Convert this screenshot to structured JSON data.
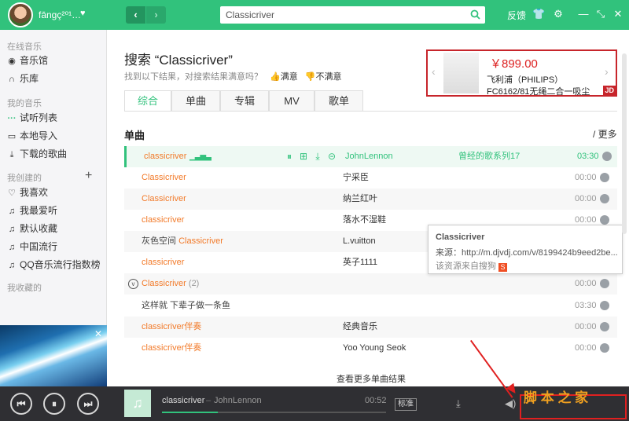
{
  "topbar": {
    "username": "fāngç²⁰¹…",
    "search_value": "Classicriver",
    "feedback": "反馈",
    "icons": [
      "shirt-icon",
      "gear-icon",
      "minimize-icon",
      "shrink-icon",
      "close-icon"
    ]
  },
  "sidebar": {
    "section_online": "在线音乐",
    "online_items": [
      {
        "label": "音乐馆",
        "icon": "music-hall-icon"
      },
      {
        "label": "乐库",
        "icon": "headphone-icon"
      }
    ],
    "section_my": "我的音乐",
    "my_items": [
      {
        "label": "试听列表",
        "icon": "playlist-icon"
      },
      {
        "label": "本地导入",
        "icon": "monitor-icon"
      },
      {
        "label": "下载的歌曲",
        "icon": "download-icon"
      }
    ],
    "section_created": "我创建的",
    "created_items": [
      {
        "label": "我喜欢",
        "icon": "heart-icon"
      },
      {
        "label": "我最爱听",
        "icon": "note-icon"
      },
      {
        "label": "默认收藏",
        "icon": "note-icon"
      },
      {
        "label": "中国流行",
        "icon": "note-icon"
      },
      {
        "label": "QQ音乐流行指数榜",
        "icon": "note-icon"
      }
    ],
    "section_collected": "我收藏的"
  },
  "main": {
    "title": "搜索 “Classicriver”",
    "subline_text": "找到以下结果，对搜索结果满意吗？",
    "satisfied": "满意",
    "unsatisfied": "不满意",
    "ad": {
      "price": "￥899.00",
      "line1": "飞利浦（PHILIPS）",
      "line2": "FC6162/81无绳二合一吸尘",
      "badge": "JD"
    },
    "tabs": [
      "综合",
      "单曲",
      "专辑",
      "MV",
      "歌单"
    ],
    "section_title": "单曲",
    "more": "/ 更多",
    "songs": [
      {
        "pre": "",
        "name": "classicriver",
        "cnt": "",
        "singer": "JohnLennon",
        "album": "曾经的歌系列17",
        "dur": "03:30"
      },
      {
        "pre": "",
        "name": "Classicriver",
        "cnt": "",
        "singer": "宁采臣",
        "album": "",
        "dur": "00:00"
      },
      {
        "pre": "",
        "name": "Classicriver",
        "cnt": "",
        "singer": "纳兰红叶",
        "album": "",
        "dur": "00:00"
      },
      {
        "pre": "",
        "name": "classicriver",
        "cnt": "",
        "singer": "落水不湿鞋",
        "album": "",
        "dur": "00:00"
      },
      {
        "pre": "灰色空间 ",
        "name": "Classicriver",
        "cnt": "",
        "singer": "L.vuitton",
        "album": "",
        "dur": ""
      },
      {
        "pre": "",
        "name": "classicriver",
        "cnt": "",
        "singer": "英子1111",
        "album": "",
        "dur": ""
      },
      {
        "pre": "",
        "name": "Classicriver",
        "cnt": " (2)",
        "singer": "",
        "album": "",
        "dur": "00:00"
      },
      {
        "pre": "这样就 下辈子做一条鱼",
        "name": "",
        "cnt": "",
        "singer": "",
        "album": "",
        "dur": "03:30"
      },
      {
        "pre": "",
        "name": "classicriver伴奏",
        "cnt": "",
        "singer": "经典音乐",
        "album": "",
        "dur": "00:00"
      },
      {
        "pre": "",
        "name": "classicriver伴奏",
        "cnt": "",
        "singer": "Yoo Young Seok",
        "album": "",
        "dur": "00:00"
      }
    ],
    "tooltip": {
      "title": "Classicriver",
      "source": "来源：http://m.djvdj.com/v/8199424b9eed2be...",
      "from": "该资源来自搜狗",
      "sogou_glyph": "S"
    },
    "view_more": "查看更多单曲结果"
  },
  "player": {
    "song": "classicriver",
    "sep": "–",
    "artist": "JohnLennon",
    "time": "00:52",
    "progress": 0.25,
    "quality": "标准"
  },
  "overlay": {
    "watermark": "脚 本 之 家",
    "accent": "#e02020"
  },
  "colors": {
    "brand": "#31c27c",
    "accent_song": "#f27a29",
    "player_bg": "#2f2f33"
  }
}
